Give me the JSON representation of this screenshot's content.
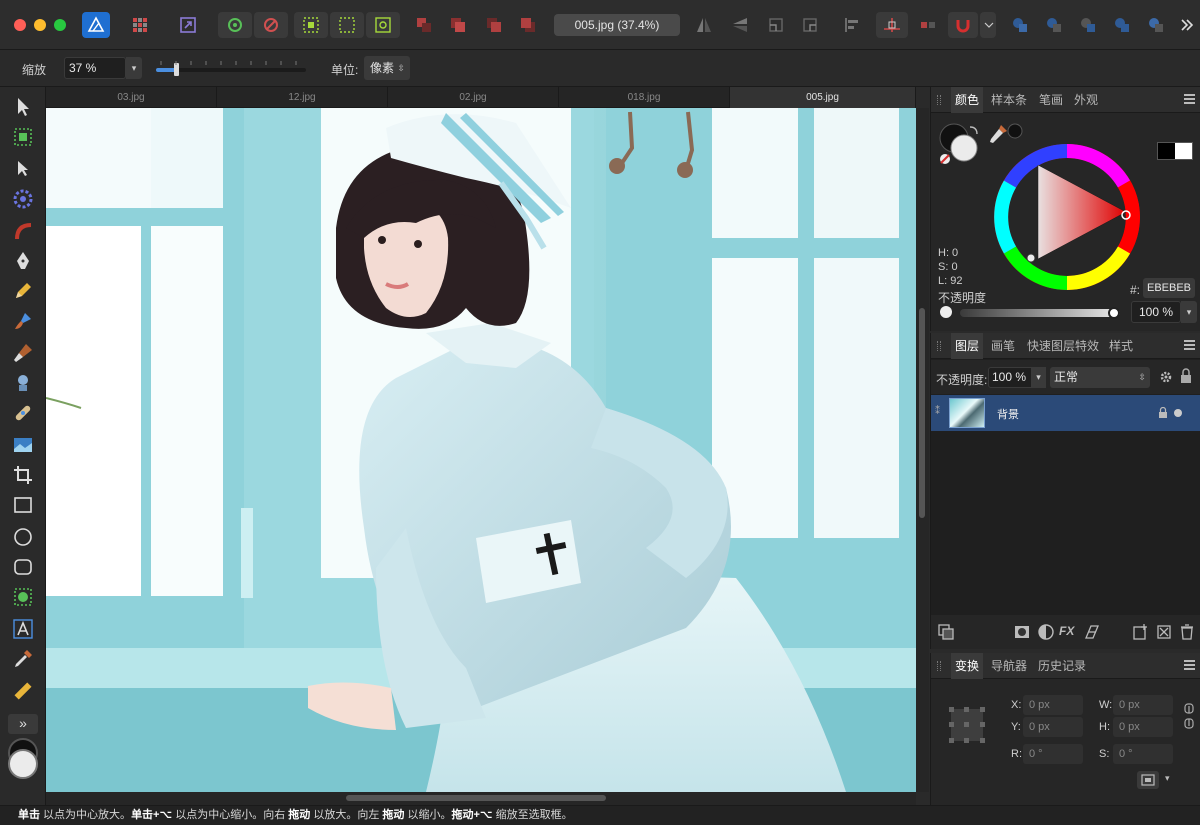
{
  "app": {
    "document_title": "005.jpg (37.4%)"
  },
  "context_toolbar": {
    "zoom_label": "缩放",
    "zoom_value": "37 %",
    "zoom_slider_fraction": 0.13,
    "unit_label": "单位:",
    "unit_value": "像素"
  },
  "document_tabs": [
    {
      "label": "03.jpg",
      "active": false
    },
    {
      "label": "12.jpg",
      "active": false
    },
    {
      "label": "02.jpg",
      "active": false
    },
    {
      "label": "018.jpg",
      "active": false
    },
    {
      "label": "005.jpg",
      "active": true
    }
  ],
  "color_panel": {
    "tabs": [
      "颜色",
      "样本条",
      "笔画",
      "外观"
    ],
    "active_tab": "颜色",
    "hsl": {
      "h": "H: 0",
      "s": "S: 0",
      "l": "L: 92"
    },
    "hex_label": "#:",
    "hex_value": "EBEBEB",
    "opacity_label": "不透明度",
    "opacity_value": "100 %",
    "opacity_fraction": 1.0,
    "current_color": "#ebebeb"
  },
  "layers_panel": {
    "tabs": [
      "图层",
      "画笔",
      "快速图层特效",
      "样式"
    ],
    "active_tab": "图层",
    "opacity_label": "不透明度:",
    "opacity_value": "100 %",
    "blend_mode": "正常",
    "layers": [
      {
        "name": "背景",
        "selected": true,
        "locked": true,
        "visible": true
      }
    ]
  },
  "transform_panel": {
    "tabs": [
      "变换",
      "导航器",
      "历史记录"
    ],
    "active_tab": "变换",
    "x_label": "X:",
    "x_value": "0 px",
    "y_label": "Y:",
    "y_value": "0 px",
    "w_label": "W:",
    "w_value": "0 px",
    "h_label": "H:",
    "h_value": "0 px",
    "r_label": "R:",
    "r_value": "0 °",
    "s_label": "S:",
    "s_value": "0 °"
  },
  "status_bar": {
    "parts": [
      {
        "text": "单击",
        "bold": true
      },
      {
        "text": " 以点为中心放大。",
        "bold": false
      },
      {
        "text": "单击+⌥",
        "bold": true
      },
      {
        "text": " 以点为中心缩小。向右 ",
        "bold": false
      },
      {
        "text": "拖动",
        "bold": true
      },
      {
        "text": " 以放大。向左 ",
        "bold": false
      },
      {
        "text": "拖动",
        "bold": true
      },
      {
        "text": " 以缩小。",
        "bold": false
      },
      {
        "text": "拖动+⌥",
        "bold": true
      },
      {
        "text": " 缩放至选取框。",
        "bold": false
      }
    ]
  },
  "colors": {
    "accent": "#4b8fe0",
    "selected_layer": "#2b4a78",
    "wheel_marker": "#d31a1a"
  }
}
